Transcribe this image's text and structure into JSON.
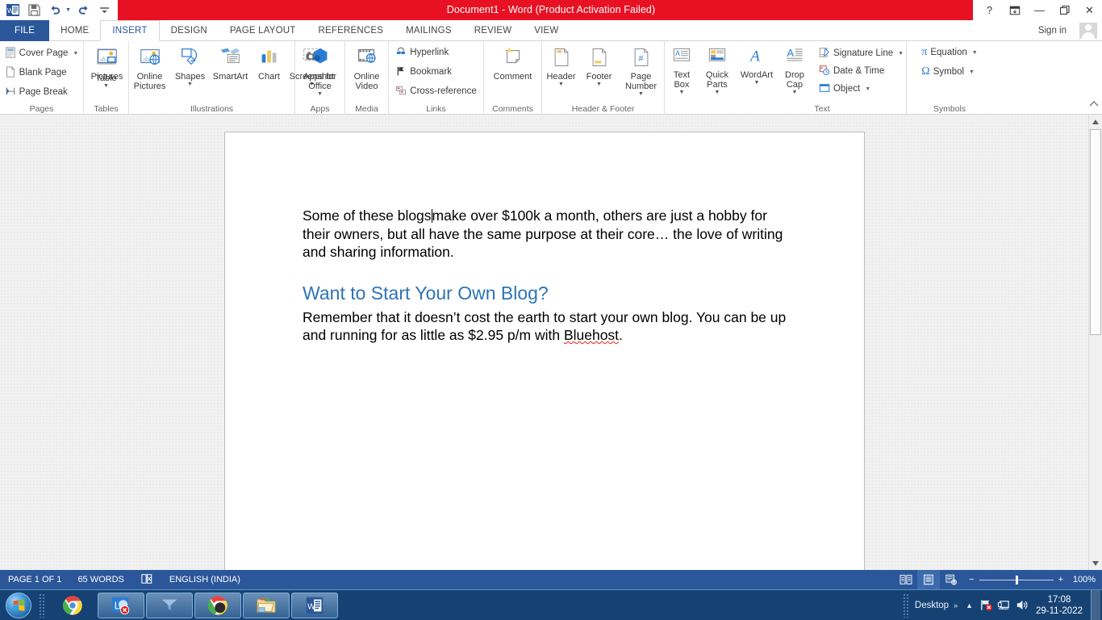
{
  "window": {
    "title": "Document1  -  Word (Product Activation Failed)",
    "quick_access": [
      {
        "name": "word-logo-icon",
        "label": "W"
      },
      {
        "name": "save-icon",
        "label": "Save"
      },
      {
        "name": "undo-icon",
        "label": "Undo"
      },
      {
        "name": "redo-icon",
        "label": "Redo"
      },
      {
        "name": "customize-qat-icon",
        "label": "Customize Quick Access Toolbar"
      }
    ],
    "controls": {
      "help": "?",
      "ribbon_display_options": "Ribbon Display Options",
      "minimize": "—",
      "restore": "❐",
      "close": "✕"
    },
    "sign_in": "Sign in",
    "titlebar_color": "#e81123",
    "accent_color": "#2b579a"
  },
  "tabs": [
    {
      "label": "FILE",
      "active": false,
      "file": true
    },
    {
      "label": "HOME",
      "active": false
    },
    {
      "label": "INSERT",
      "active": true
    },
    {
      "label": "DESIGN",
      "active": false
    },
    {
      "label": "PAGE LAYOUT",
      "active": false
    },
    {
      "label": "REFERENCES",
      "active": false
    },
    {
      "label": "MAILINGS",
      "active": false
    },
    {
      "label": "REVIEW",
      "active": false
    },
    {
      "label": "VIEW",
      "active": false
    }
  ],
  "ribbon": {
    "groups": [
      {
        "label": "Pages",
        "type": "small",
        "items": [
          {
            "label": "Cover Page",
            "icon": "cover-page-icon",
            "caret": true
          },
          {
            "label": "Blank Page",
            "icon": "blank-page-icon",
            "caret": false
          },
          {
            "label": "Page Break",
            "icon": "page-break-icon",
            "caret": false
          }
        ]
      },
      {
        "label": "Tables",
        "type": "big",
        "items": [
          {
            "label": "Table",
            "icon": "table-icon",
            "caret": true
          }
        ]
      },
      {
        "label": "Illustrations",
        "type": "big",
        "items": [
          {
            "label": "Pictures",
            "icon": "pictures-icon",
            "caret": false
          },
          {
            "label": "Online\nPictures",
            "icon": "online-pictures-icon",
            "caret": false
          },
          {
            "label": "Shapes",
            "icon": "shapes-icon",
            "caret": true
          },
          {
            "label": "SmartArt",
            "icon": "smartart-icon",
            "caret": false
          },
          {
            "label": "Chart",
            "icon": "chart-icon",
            "caret": false
          },
          {
            "label": "Screenshot",
            "icon": "screenshot-icon",
            "caret": true
          }
        ]
      },
      {
        "label": "Apps",
        "type": "big",
        "items": [
          {
            "label": "Apps for\nOffice",
            "icon": "apps-for-office-icon",
            "caret": true
          }
        ]
      },
      {
        "label": "Media",
        "type": "big",
        "items": [
          {
            "label": "Online\nVideo",
            "icon": "online-video-icon",
            "caret": false
          }
        ]
      },
      {
        "label": "Links",
        "type": "small",
        "items": [
          {
            "label": "Hyperlink",
            "icon": "hyperlink-icon",
            "caret": false
          },
          {
            "label": "Bookmark",
            "icon": "bookmark-icon",
            "caret": false
          },
          {
            "label": "Cross-reference",
            "icon": "cross-reference-icon",
            "caret": false
          }
        ]
      },
      {
        "label": "Comments",
        "type": "big",
        "items": [
          {
            "label": "Comment",
            "icon": "comment-icon",
            "caret": false
          }
        ]
      },
      {
        "label": "Header & Footer",
        "type": "big",
        "items": [
          {
            "label": "Header",
            "icon": "header-icon",
            "caret": true
          },
          {
            "label": "Footer",
            "icon": "footer-icon",
            "caret": true
          },
          {
            "label": "Page\nNumber",
            "icon": "page-number-icon",
            "caret": true
          }
        ]
      },
      {
        "label": "Text",
        "type": "big",
        "items": [
          {
            "label": "Text\nBox",
            "icon": "text-box-icon",
            "caret": true
          },
          {
            "label": "Quick\nParts",
            "icon": "quick-parts-icon",
            "caret": true
          },
          {
            "label": "WordArt",
            "icon": "wordart-icon",
            "caret": true
          },
          {
            "label": "Drop\nCap",
            "icon": "drop-cap-icon",
            "caret": true
          }
        ],
        "small_items": [
          {
            "label": "Signature Line",
            "icon": "signature-line-icon",
            "caret": true
          },
          {
            "label": "Date & Time",
            "icon": "date-time-icon",
            "caret": false
          },
          {
            "label": "Object",
            "icon": "object-icon",
            "caret": true
          }
        ]
      },
      {
        "label": "Symbols",
        "type": "small",
        "items": [
          {
            "label": "Equation",
            "icon": "equation-icon",
            "caret": true
          },
          {
            "label": "Symbol",
            "icon": "symbol-icon",
            "caret": true
          }
        ]
      }
    ],
    "collapse_icon": "collapse-ribbon-icon"
  },
  "document": {
    "paragraph1_a": "Some of these blogs",
    "paragraph1_b": "make over $100k a month, others are just a hobby for their owners, but all have the same purpose at their core… the love of writing and sharing information.",
    "heading": "Want to Start Your Own Blog?",
    "heading_color": "#2e74b5",
    "paragraph2_a": "Remember that it doesn’t cost the earth to start your own blog. You can be up and running for as little as $2.95 p/m with ",
    "paragraph2_misspelled": "Bluehost",
    "paragraph2_b": "."
  },
  "status_bar": {
    "page": "PAGE 1 OF 1",
    "words": "65 WORDS",
    "proofing_icon": "proofing-errors-icon",
    "language": "ENGLISH (INDIA)",
    "views": [
      {
        "name": "read-mode-icon",
        "selected": false
      },
      {
        "name": "print-layout-icon",
        "selected": true
      },
      {
        "name": "web-layout-icon",
        "selected": false
      }
    ],
    "zoom_out": "−",
    "zoom_in": "+",
    "zoom_level": "100%"
  },
  "taskbar": {
    "start": "start-orb-icon",
    "items": [
      {
        "name": "taskbar-chrome-pinned",
        "icon": "chrome-icon",
        "open": false
      },
      {
        "name": "taskbar-lync",
        "icon": "lync-icon",
        "open": true
      },
      {
        "name": "taskbar-teams",
        "icon": "teams-icon",
        "open": true
      },
      {
        "name": "taskbar-chrome",
        "icon": "chrome-icon",
        "open": true
      },
      {
        "name": "taskbar-explorer",
        "icon": "folder-icon",
        "open": true
      },
      {
        "name": "taskbar-word",
        "icon": "word-icon",
        "open": true
      }
    ],
    "desktop_label": "Desktop",
    "overflow": "»",
    "tray": [
      {
        "name": "network-icon"
      },
      {
        "name": "display-icon"
      },
      {
        "name": "volume-icon"
      }
    ],
    "time": "17:08",
    "date": "29-11-2022"
  }
}
